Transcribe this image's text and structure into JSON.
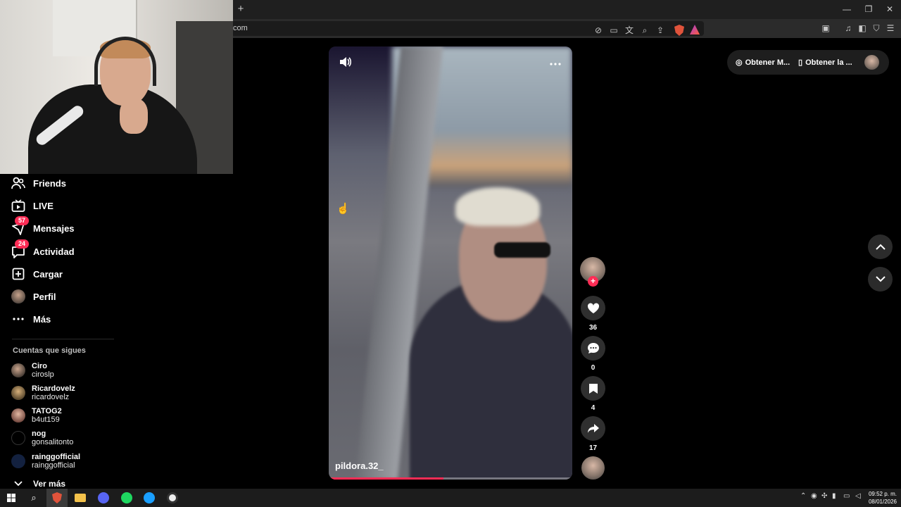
{
  "browser": {
    "new_tab_label": "+",
    "url": "com",
    "window_controls": {
      "minimize": "—",
      "restore": "❐",
      "close": "✕"
    }
  },
  "sidebar": {
    "items": [
      {
        "label": "Friends",
        "icon": "friends-icon"
      },
      {
        "label": "LIVE",
        "icon": "live-icon"
      },
      {
        "label": "Mensajes",
        "icon": "messages-icon",
        "badge": "57"
      },
      {
        "label": "Actividad",
        "icon": "activity-icon",
        "badge": "24"
      },
      {
        "label": "Cargar",
        "icon": "upload-icon"
      },
      {
        "label": "Perfil",
        "icon": "avatar"
      },
      {
        "label": "Más",
        "icon": "more-icon"
      }
    ],
    "following_title": "Cuentas que sigues",
    "following": [
      {
        "name": "Ciro",
        "username": "ciroslp"
      },
      {
        "name": "Ricardovelz",
        "username": "ricardovelz"
      },
      {
        "name": "TATOG2",
        "username": "b4ut159"
      },
      {
        "name": "nog",
        "username": "gonsalitonto"
      },
      {
        "name": "rainggofficial",
        "username": "rainggofficial"
      }
    ],
    "see_more": "Ver más"
  },
  "video": {
    "username": "pildora.32_",
    "progress_fraction": 0.47
  },
  "actions": {
    "likes": "36",
    "comments": "0",
    "saves": "4",
    "shares": "17"
  },
  "top_right": {
    "get_app_1": "Obtener M...",
    "get_app_2": "Obtener la ..."
  },
  "taskbar": {
    "time": "09:52 p. m.",
    "date": "08/01/2026"
  },
  "colors": {
    "accent": "#fe2c55",
    "background": "#000000"
  }
}
